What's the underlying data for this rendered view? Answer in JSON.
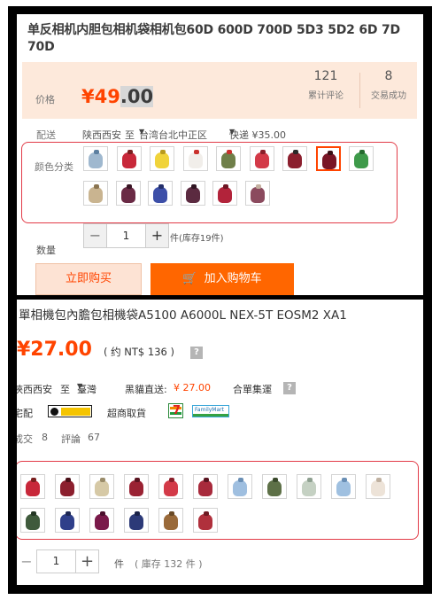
{
  "top": {
    "title": "单反相机内胆包相机袋相机包60D 600D 700D 5D3 5D2 6D 7D 70D",
    "price_label": "价格",
    "currency": "¥",
    "price_int": "49",
    "price_dec": ".00",
    "review_count": "121",
    "review_label": "累计评论",
    "trade_count": "8",
    "trade_label": "交易成功",
    "ship_label": "配送",
    "ship_from": "陕西西安",
    "ship_to_word": "至",
    "ship_to": "台湾台北中正区",
    "ship_method": "快递 ¥35.00",
    "color_label": "颜色分类",
    "swatches": [
      {
        "color": "#9fb8cf",
        "knot": "#5c7fa0"
      },
      {
        "color": "#c8283a",
        "knot": "#7a2020"
      },
      {
        "color": "#f0d33a",
        "knot": "#b89a1e"
      },
      {
        "color": "#f1eeea",
        "knot": "#c9302c"
      },
      {
        "color": "#6f7f49",
        "knot": "#c9302c"
      },
      {
        "color": "#d33a48",
        "knot": "#8a1f2a"
      },
      {
        "color": "#8c1f2e",
        "knot": "#2a2a2a"
      },
      {
        "color": "#7a1626",
        "knot": "#3a1015"
      },
      {
        "color": "#3e9a4a",
        "knot": "#246a2e"
      },
      {
        "color": "#c9b490",
        "knot": "#8a7450"
      },
      {
        "color": "#6a2a45",
        "knot": "#3a1525"
      },
      {
        "color": "#3d4fa8",
        "knot": "#232f6a"
      },
      {
        "color": "#5b2a40",
        "knot": "#2f1522"
      },
      {
        "color": "#b2233a",
        "knot": "#6e1623"
      },
      {
        "color": "#8b4a5e",
        "knot": "#c4b0a0"
      }
    ],
    "qty_label": "数量",
    "qty_minus": "−",
    "qty_value": "1",
    "qty_plus": "+",
    "stock_text": "件(库存19件)",
    "buy_now": "立即购买",
    "add_to_cart": "加入购物车",
    "cart_icon": "🛒"
  },
  "bottom": {
    "title": "單相機包內膽包相機袋A5100 A6000L NEX-5T EOSM2 XA1",
    "price": "¥27.00",
    "price_twd": "( 约 NT$ 136 )",
    "help_mark": "?",
    "ship_from": "陝西西安",
    "ship_to_word": "至",
    "ship_to": "臺灣",
    "direct_label": "黑貓直送:",
    "direct_price": "¥ 27.00",
    "consolidated": "合單集運",
    "delivery_label": "宅配",
    "convenience_label": "超商取貨",
    "fm_text": "FamilyMart",
    "deals_label": "成交",
    "deals_count": "8",
    "reviews_label": "評論",
    "reviews_count": "67",
    "swatches": [
      {
        "color": "#c8283a",
        "knot": "#7a2020"
      },
      {
        "color": "#8c1f2e",
        "knot": "#4a1018"
      },
      {
        "color": "#d6c9a6",
        "knot": "#9a8c6a"
      },
      {
        "color": "#9a2233",
        "knot": "#5a1420"
      },
      {
        "color": "#d33a48",
        "knot": "#8a1f2a"
      },
      {
        "color": "#a82a3c",
        "knot": "#5a1420"
      },
      {
        "color": "#9fbfe0",
        "knot": "#6a8fb5"
      },
      {
        "color": "#5d7047",
        "knot": "#3a4a2c"
      },
      {
        "color": "#c5d1c3",
        "knot": "#8ea090"
      },
      {
        "color": "#9fc0e0",
        "knot": "#6a8fb5"
      },
      {
        "color": "#ede3d8",
        "knot": "#bfb0a0"
      },
      {
        "color": "#3f5a3c",
        "knot": "#243624"
      },
      {
        "color": "#2f3f8a",
        "knot": "#1c2652"
      },
      {
        "color": "#7a1a4a",
        "knot": "#4a0f2c"
      },
      {
        "color": "#2c3a78",
        "knot": "#1a2248"
      },
      {
        "color": "#9a6a3a",
        "knot": "#6a4a26"
      },
      {
        "color": "#b0303c",
        "knot": "#6e1a22"
      }
    ],
    "qty_minus": "−",
    "qty_value": "1",
    "qty_plus": "+",
    "unit": "件",
    "stock_text": "( 庫存 132 件 )"
  }
}
